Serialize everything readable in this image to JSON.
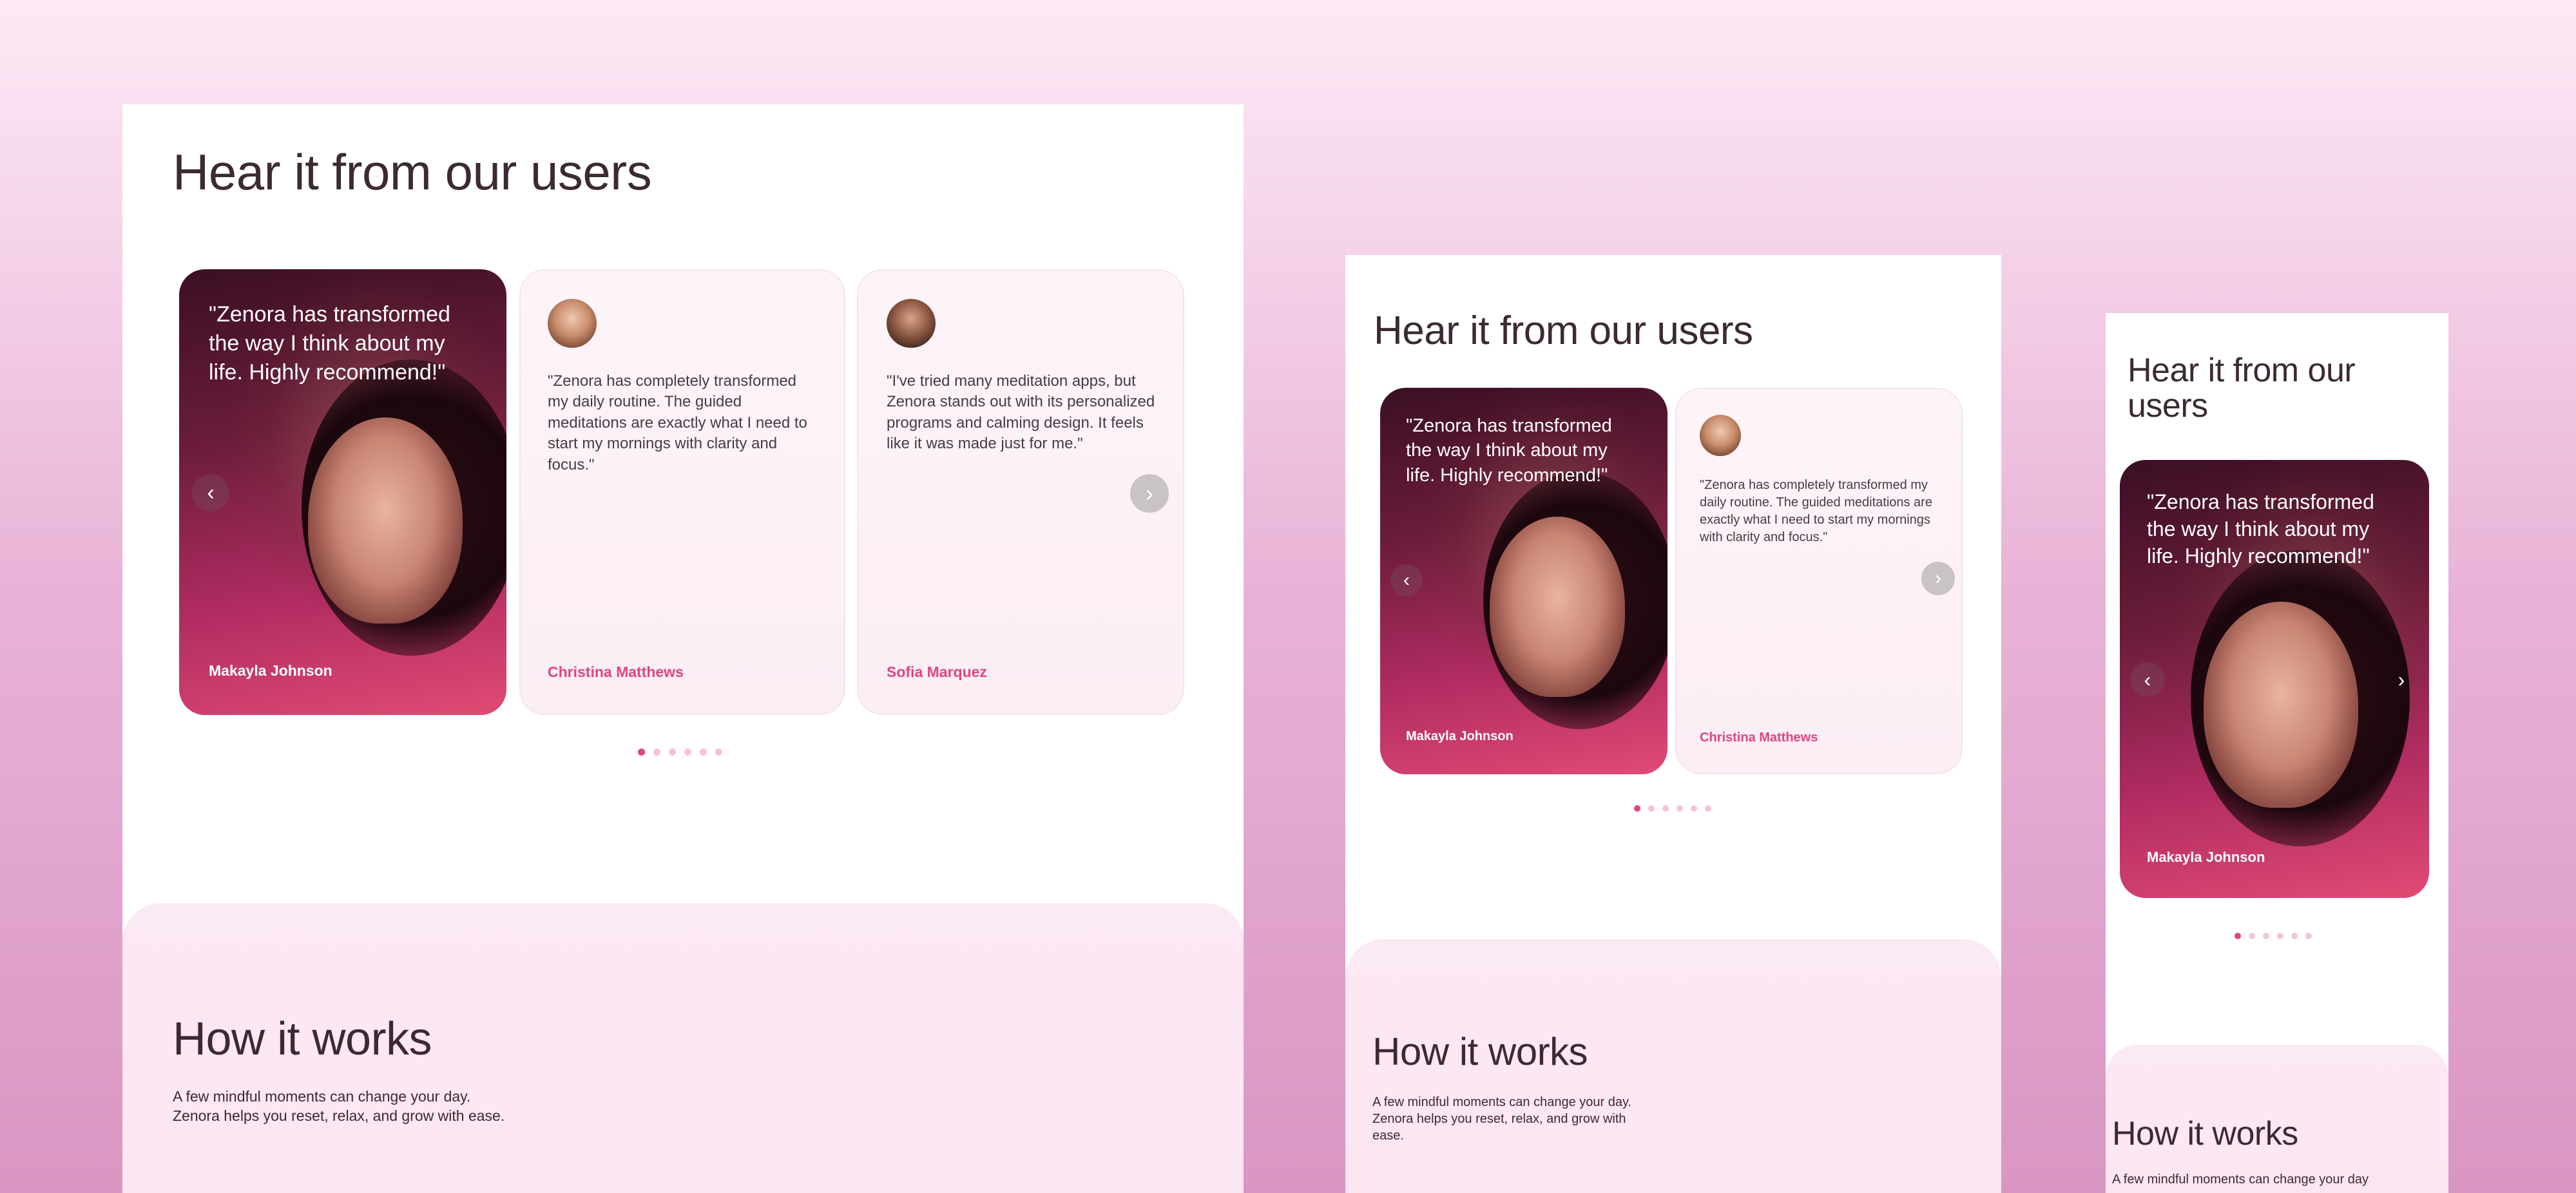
{
  "testimonials": {
    "heading": "Hear it from our users",
    "heading_mobile_line1": "Hear it from our",
    "heading_mobile_line2": "users",
    "items": [
      {
        "quote_line1": "\"Zenora has transformed",
        "quote_line2": "the way I think about my",
        "quote_line3": "life. Highly recommend!\"",
        "name": "Makayla Johnson"
      },
      {
        "quote": "\"Zenora has completely transformed my daily routine. The guided meditations are exactly what I need to start my mornings with clarity and focus.\"",
        "name": "Christina Matthews"
      },
      {
        "quote": "\"I've tried many meditation apps, but Zenora stands out with its personalized programs and calming design. It feels like it was made just for me.\"",
        "name": "Sofia Marquez"
      }
    ],
    "prev_icon": "chevron-left-icon",
    "next_icon": "chevron-right-icon",
    "dots_count": 6,
    "active_dot": 0
  },
  "how_it_works": {
    "heading": "How it works",
    "description": "A few mindful moments can change your day. Zenora helps you reset, relax, and grow with ease.",
    "description_mobile_visible": "A few mindful moments can change your day"
  },
  "colors": {
    "accent": "#e0457f",
    "heading": "#3c2a33",
    "background_top": "#fdeaf6",
    "background_bottom": "#d996c2"
  }
}
